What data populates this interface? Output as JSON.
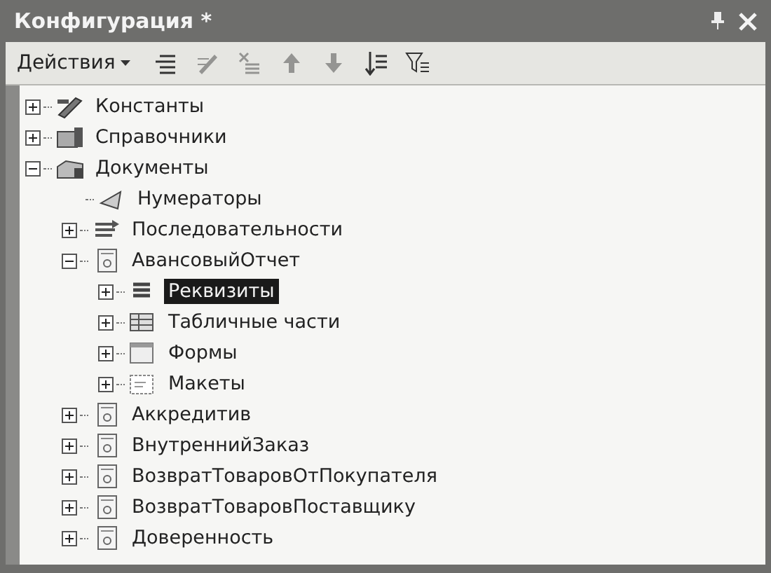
{
  "window": {
    "title": "Конфигурация *"
  },
  "toolbar": {
    "menu": "Действия",
    "buttons": [
      {
        "kind": "add",
        "disabled": false
      },
      {
        "kind": "edit",
        "disabled": true
      },
      {
        "kind": "delete",
        "disabled": true
      },
      {
        "kind": "up",
        "disabled": true
      },
      {
        "kind": "down",
        "disabled": true
      },
      {
        "kind": "sort",
        "disabled": false
      },
      {
        "kind": "filter",
        "disabled": false
      }
    ]
  },
  "tree": [
    {
      "label": "Константы",
      "kind": "constants",
      "expanded": false,
      "selected": false
    },
    {
      "label": "Справочники",
      "kind": "catalogs",
      "expanded": false,
      "selected": false
    },
    {
      "label": "Документы",
      "kind": "documents",
      "expanded": true,
      "selected": false,
      "children": [
        {
          "label": "Нумераторы",
          "kind": "numerators",
          "selected": false
        },
        {
          "label": "Последовательности",
          "kind": "sequences",
          "expanded": false,
          "selected": false
        },
        {
          "label": "АвансовыйОтчет",
          "kind": "document",
          "expanded": true,
          "selected": false,
          "children": [
            {
              "label": "Реквизиты",
              "kind": "attributes",
              "expanded": false,
              "selected": true
            },
            {
              "label": "Табличные части",
              "kind": "tables",
              "expanded": false,
              "selected": false
            },
            {
              "label": "Формы",
              "kind": "forms",
              "expanded": false,
              "selected": false
            },
            {
              "label": "Макеты",
              "kind": "templates",
              "expanded": false,
              "selected": false
            }
          ]
        },
        {
          "label": "Аккредитив",
          "kind": "document",
          "expanded": false,
          "selected": false
        },
        {
          "label": "ВнутреннийЗаказ",
          "kind": "document",
          "expanded": false,
          "selected": false
        },
        {
          "label": "ВозвратТоваровОтПокупателя",
          "kind": "document",
          "expanded": false,
          "selected": false
        },
        {
          "label": "ВозвратТоваровПоставщику",
          "kind": "document",
          "expanded": false,
          "selected": false
        },
        {
          "label": "Доверенность",
          "kind": "document",
          "expanded": false,
          "selected": false
        }
      ]
    }
  ]
}
